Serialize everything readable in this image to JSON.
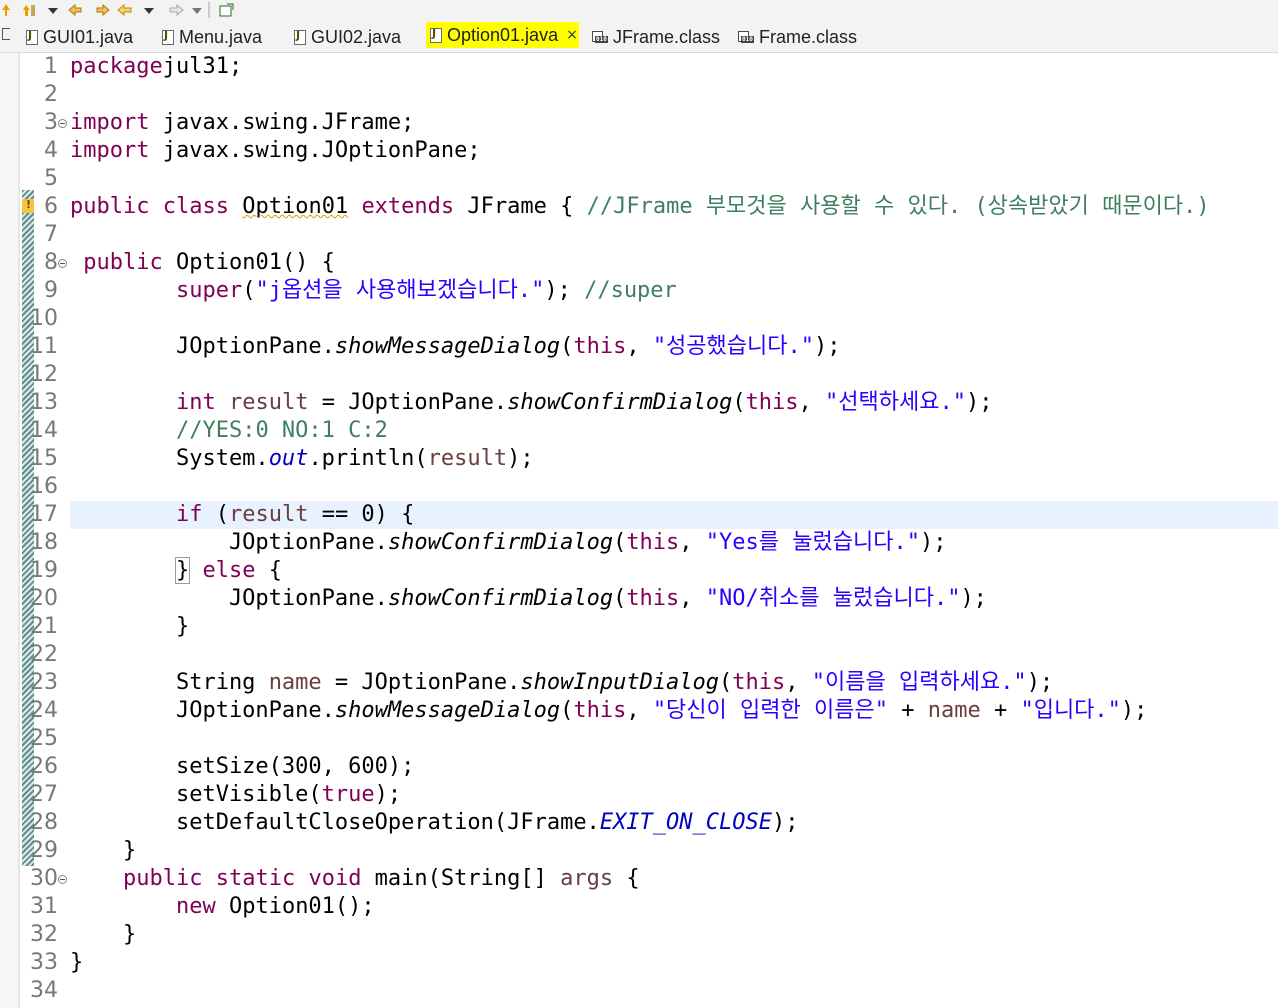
{
  "toolbar": {
    "icons": [
      "up-arrow-icon",
      "dropdown-icon",
      "prev-edit-icon",
      "next-edit-icon",
      "back-icon",
      "dropdown-icon",
      "forward-icon",
      "dropdown-icon",
      "new-window-icon"
    ]
  },
  "tabs": [
    {
      "label": "GUI01.java",
      "type": "java",
      "active": false
    },
    {
      "label": "Menu.java",
      "type": "java",
      "active": false
    },
    {
      "label": "GUI02.java",
      "type": "java",
      "active": false
    },
    {
      "label": "Option01.java",
      "type": "java",
      "active": true,
      "close": "×"
    },
    {
      "label": "JFrame.class",
      "type": "class",
      "active": false
    },
    {
      "label": "Frame.class",
      "type": "class",
      "active": false
    }
  ],
  "editor": {
    "line_numbers": [
      "1",
      "2",
      "3",
      "4",
      "5",
      "6",
      "7",
      "8",
      "9",
      "10",
      "11",
      "12",
      "13",
      "14",
      "15",
      "16",
      "17",
      "18",
      "19",
      "20",
      "21",
      "22",
      "23",
      "24",
      "25",
      "26",
      "27",
      "28",
      "29",
      "30",
      "31",
      "32",
      "33",
      "34"
    ],
    "current_line": "17",
    "lines": [
      [
        [
          "kw",
          "package"
        ],
        [
          "",
          "jul31;"
        ]
      ],
      [],
      [
        [
          "kw",
          "import"
        ],
        [
          "",
          " javax.swing.JFrame;"
        ]
      ],
      [
        [
          "kw",
          "import"
        ],
        [
          "",
          " javax.swing.JOptionPane;"
        ]
      ],
      [],
      [
        [
          "kw",
          "public"
        ],
        [
          "",
          " "
        ],
        [
          "kw",
          "class"
        ],
        [
          "",
          " "
        ],
        [
          "squig",
          "Option01"
        ],
        [
          "",
          " "
        ],
        [
          "kw",
          "extends"
        ],
        [
          "",
          " JFrame { "
        ],
        [
          "cmt",
          "//JFrame 부모것을 사용할 수 있다. (상속받았기 때문이다.)"
        ]
      ],
      [],
      [
        [
          "",
          " "
        ],
        [
          "kw",
          "public"
        ],
        [
          "",
          " Option01() {"
        ]
      ],
      [
        [
          "",
          "        "
        ],
        [
          "kw",
          "super"
        ],
        [
          "",
          "("
        ],
        [
          "str",
          "\"j옵션을 사용해보겠습니다.\""
        ],
        [
          "",
          "); "
        ],
        [
          "cmt",
          "//super"
        ]
      ],
      [],
      [
        [
          "",
          "        JOptionPane."
        ],
        [
          "it",
          "showMessageDialog"
        ],
        [
          "",
          "("
        ],
        [
          "kw",
          "this"
        ],
        [
          "",
          ", "
        ],
        [
          "str",
          "\"성공했습니다.\""
        ],
        [
          "",
          ");"
        ]
      ],
      [],
      [
        [
          "",
          "        "
        ],
        [
          "kw",
          "int"
        ],
        [
          "",
          " "
        ],
        [
          "var",
          "result"
        ],
        [
          "",
          " = JOptionPane."
        ],
        [
          "it",
          "showConfirmDialog"
        ],
        [
          "",
          "("
        ],
        [
          "kw",
          "this"
        ],
        [
          "",
          ", "
        ],
        [
          "str",
          "\"선택하세요.\""
        ],
        [
          "",
          ");"
        ]
      ],
      [
        [
          "",
          "        "
        ],
        [
          "cmt",
          "//YES:0 NO:1 C:2"
        ]
      ],
      [
        [
          "",
          "        System."
        ],
        [
          "fld",
          "out"
        ],
        [
          "",
          ".println("
        ],
        [
          "var",
          "result"
        ],
        [
          "",
          ");"
        ]
      ],
      [],
      [
        [
          "",
          "        "
        ],
        [
          "kw",
          "if"
        ],
        [
          "",
          " ("
        ],
        [
          "var",
          "result"
        ],
        [
          "",
          " == 0) {"
        ]
      ],
      [
        [
          "",
          "            JOptionPane."
        ],
        [
          "it",
          "showConfirmDialog"
        ],
        [
          "",
          "("
        ],
        [
          "kw",
          "this"
        ],
        [
          "",
          ", "
        ],
        [
          "str",
          "\"Yes를 눌렀습니다.\""
        ],
        [
          "",
          ");"
        ]
      ],
      [
        [
          "",
          "        "
        ],
        [
          "brk",
          "}"
        ],
        [
          "",
          " "
        ],
        [
          "kw",
          "else"
        ],
        [
          "",
          " {"
        ]
      ],
      [
        [
          "",
          "            JOptionPane."
        ],
        [
          "it",
          "showConfirmDialog"
        ],
        [
          "",
          "("
        ],
        [
          "kw",
          "this"
        ],
        [
          "",
          ", "
        ],
        [
          "str",
          "\"NO/취소를 눌렀습니다.\""
        ],
        [
          "",
          ");"
        ]
      ],
      [
        [
          "",
          "        }"
        ]
      ],
      [],
      [
        [
          "",
          "        String "
        ],
        [
          "var",
          "name"
        ],
        [
          "",
          " = JOptionPane."
        ],
        [
          "it",
          "showInputDialog"
        ],
        [
          "",
          "("
        ],
        [
          "kw",
          "this"
        ],
        [
          "",
          ", "
        ],
        [
          "str",
          "\"이름을 입력하세요.\""
        ],
        [
          "",
          ");"
        ]
      ],
      [
        [
          "",
          "        JOptionPane."
        ],
        [
          "it",
          "showMessageDialog"
        ],
        [
          "",
          "("
        ],
        [
          "kw",
          "this"
        ],
        [
          "",
          ", "
        ],
        [
          "str",
          "\"당신이 입력한 이름은\""
        ],
        [
          "",
          " + "
        ],
        [
          "var",
          "name"
        ],
        [
          "",
          " + "
        ],
        [
          "str",
          "\"입니다.\""
        ],
        [
          "",
          ");"
        ]
      ],
      [],
      [
        [
          "",
          "        setSize(300, 600);"
        ]
      ],
      [
        [
          "",
          "        setVisible("
        ],
        [
          "kw",
          "true"
        ],
        [
          "",
          ");"
        ]
      ],
      [
        [
          "",
          "        setDefaultCloseOperation(JFrame."
        ],
        [
          "fld",
          "EXIT_ON_CLOSE"
        ],
        [
          "",
          ");"
        ]
      ],
      [
        [
          "",
          "    }"
        ]
      ],
      [
        [
          "",
          "    "
        ],
        [
          "kw",
          "public"
        ],
        [
          "",
          " "
        ],
        [
          "kw",
          "static"
        ],
        [
          "",
          " "
        ],
        [
          "kw",
          "void"
        ],
        [
          "",
          " main(String[] "
        ],
        [
          "var",
          "args"
        ],
        [
          "",
          " {"
        ]
      ],
      [
        [
          "",
          "        "
        ],
        [
          "kw",
          "new"
        ],
        [
          "",
          " Option01();"
        ]
      ],
      [
        [
          "",
          "    }"
        ]
      ],
      [
        [
          "",
          "}"
        ]
      ],
      []
    ],
    "fold_lines": [
      "3",
      "8",
      "30"
    ],
    "warning_line": "6"
  },
  "colors": {
    "keyword": "#7f0055",
    "string": "#2a00ff",
    "comment": "#3f7f5f",
    "field": "#0000c0",
    "local_var": "#6a3e3e",
    "active_tab": "#ffff00",
    "current_line": "#e8f2fe"
  }
}
